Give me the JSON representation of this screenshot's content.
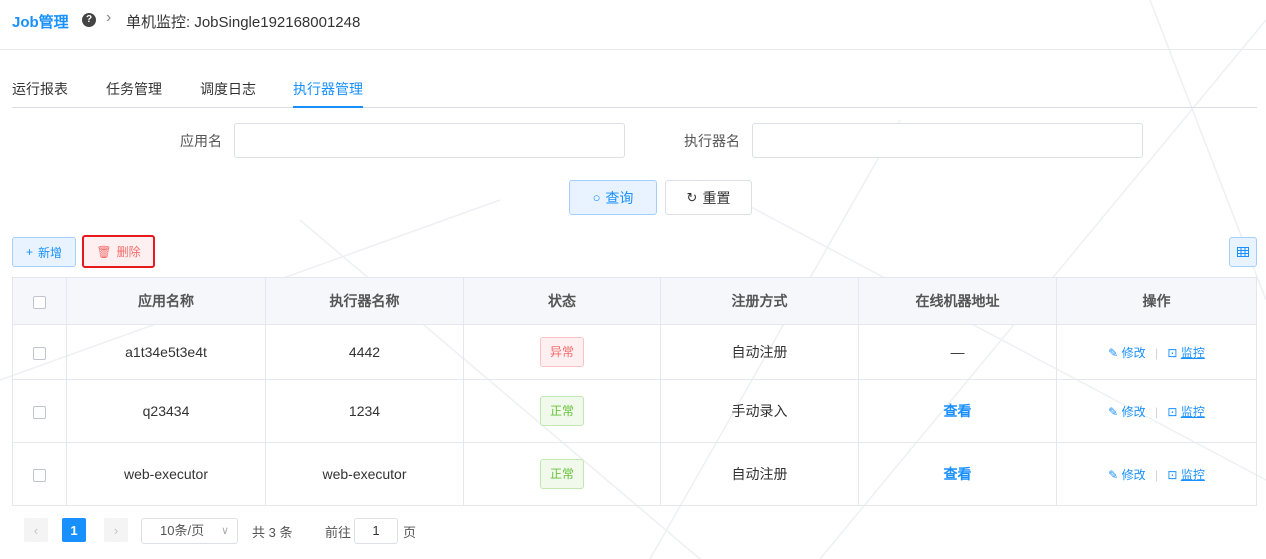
{
  "header": {
    "brand_job": "Job",
    "brand_manage": "管理",
    "breadcrumb_label": "单机监控:",
    "breadcrumb_value": "JobSingle192168001248"
  },
  "tabs": [
    {
      "label": "运行报表",
      "active": false
    },
    {
      "label": "任务管理",
      "active": false
    },
    {
      "label": "调度日志",
      "active": false
    },
    {
      "label": "执行器管理",
      "active": true
    }
  ],
  "form": {
    "app_name_label": "应用名",
    "app_name_value": "",
    "executor_name_label": "执行器名",
    "executor_name_value": "",
    "search_label": "查询",
    "reset_label": "重置"
  },
  "toolbar": {
    "add_label": "新增",
    "delete_label": "删除"
  },
  "table": {
    "headers": [
      "应用名称",
      "执行器名称",
      "状态",
      "注册方式",
      "在线机器地址",
      "操作"
    ],
    "rows": [
      {
        "app": "a1t34e5t3e4t",
        "executor": "4442",
        "status": "异常",
        "status_type": "error",
        "reg": "自动注册",
        "addr": "—",
        "addr_link": false
      },
      {
        "app": "q23434",
        "executor": "1234",
        "status": "正常",
        "status_type": "ok",
        "reg": "手动录入",
        "addr": "查看",
        "addr_link": true
      },
      {
        "app": "web-executor",
        "executor": "web-executor",
        "status": "正常",
        "status_type": "ok",
        "reg": "自动注册",
        "addr": "查看",
        "addr_link": true
      }
    ],
    "op_edit": "修改",
    "op_monitor": "监控"
  },
  "pagination": {
    "current_page": "1",
    "page_size": "10条/页",
    "total": "共 3 条",
    "goto_prefix": "前往",
    "goto_value": "1",
    "goto_suffix": "页"
  },
  "colors": {
    "primary": "#1890ff",
    "danger": "#f56c6c",
    "success": "#67c23a",
    "highlight_border": "#e6191e"
  }
}
